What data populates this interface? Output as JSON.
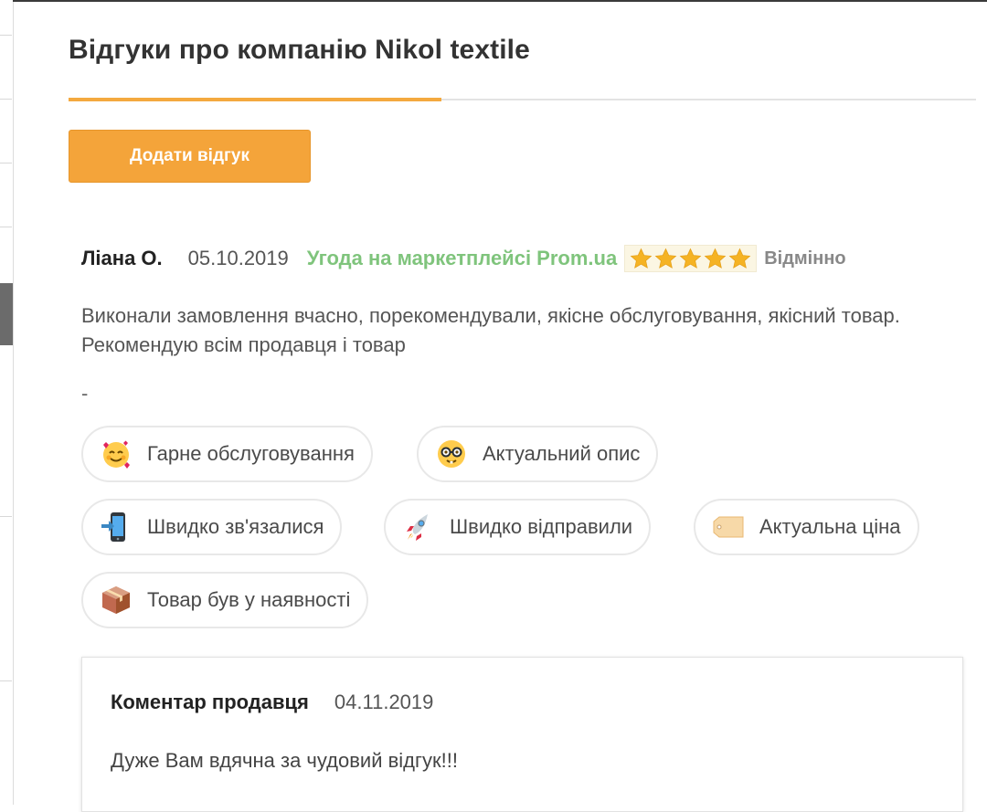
{
  "title": "Відгуки про компанію Nikol textile",
  "add_review_label": "Додати відгук",
  "review": {
    "author": "Ліана О.",
    "date": "05.10.2019",
    "marketplace": "Угода на маркетплейсі Prom.ua",
    "rating": 5,
    "rating_max": 5,
    "rating_label": "Відмінно",
    "text": "Виконали замовлення вчасно, порекомендували, якісне обслуговування, якісний товар. Рекомендую всім продавця і товар",
    "extra": "-",
    "tags": [
      {
        "label": "Гарне обслуговування",
        "icon": "smiling-face-with-hearts-icon"
      },
      {
        "label": "Актуальний опис",
        "icon": "nerd-face-icon"
      },
      {
        "label": "Швидко зв'язалися",
        "icon": "mobile-phone-arrow-icon"
      },
      {
        "label": "Швидко відправили",
        "icon": "rocket-icon"
      },
      {
        "label": "Актуальна ціна",
        "icon": "price-tag-icon"
      },
      {
        "label": "Товар був у наявності",
        "icon": "package-icon"
      }
    ]
  },
  "seller_comment": {
    "label": "Коментар продавця",
    "date": "04.11.2019",
    "text": "Дуже Вам вдячна за чудовий відгук!!!"
  },
  "colors": {
    "accent": "#f4a43a",
    "marketplace_green": "#7fc47c",
    "star": "#f5b324"
  }
}
